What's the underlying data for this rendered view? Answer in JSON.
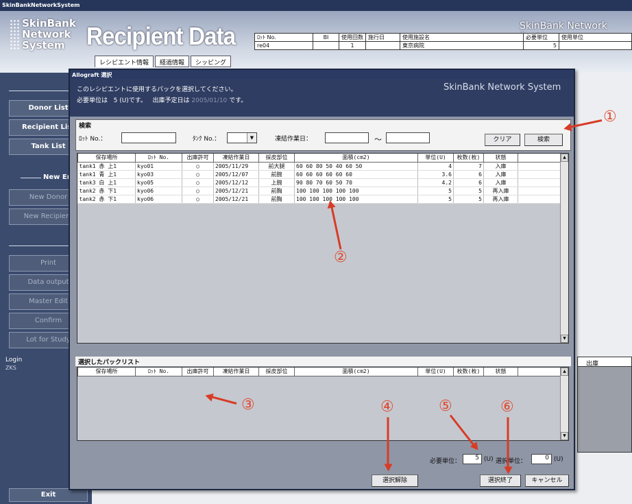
{
  "window": {
    "title": "SkinBankNetworkSystem"
  },
  "logo": {
    "line1": "SkinBank",
    "line2": "Network",
    "line3": "System"
  },
  "banner": {
    "title": "Recipient Data",
    "system_name": "SkinBank Network System"
  },
  "tabs": [
    "レシピエント情報",
    "経過情報",
    "シッピング"
  ],
  "header_table": {
    "headers": [
      "ﾛｯﾄ No.",
      "BI",
      "使用回数",
      "施行日",
      "使用施設名",
      "必要単位",
      "使用単位"
    ],
    "row": [
      "re04",
      "",
      "1",
      "",
      "東京病院",
      "5",
      ""
    ]
  },
  "sidebar": {
    "buttons": [
      "Donor List",
      "Recipient List",
      "Tank List"
    ],
    "section_new": "New Entry",
    "new_buttons": [
      "New Donor",
      "New Recipient"
    ],
    "ops": [
      "Print",
      "Data output",
      "Master Edit",
      "Confirm",
      "Lot for Study"
    ],
    "login_label": "Login",
    "login_user": "ZKS",
    "exit": "Exit"
  },
  "background": {
    "col_header": "出庫"
  },
  "dialog": {
    "title": "Allograft 選択",
    "system_name": "SkinBank Network System",
    "message": "このレシピエントに使用するパックを選択してください。",
    "required_prefix": "必要単位は",
    "required_value": "5 (U)です。",
    "date_prefix": "出庫予定日は",
    "date_value": "2005/01/10",
    "date_suffix": "です。",
    "search": {
      "section_label": "検索",
      "lot_label": "ﾛｯﾄ No.：",
      "tank_label": "ﾀﾝｸ No.：",
      "date_label": "凍結作業日：",
      "tilde": "～",
      "clear_button": "クリア",
      "search_button": "検索"
    },
    "grid_headers": [
      "保存場所",
      "ﾛｯﾄ No.",
      "出庫許可",
      "凍結作業日",
      "採皮部位",
      "面積(cm2)",
      "単位(U)",
      "枚数(枚)",
      "状態"
    ],
    "rows": [
      [
        "tank1 赤 上1",
        "kyo01",
        "○",
        "2005/11/29",
        "前大腿",
        "60 60 80 50 40 60 50",
        "4",
        "7",
        "入庫"
      ],
      [
        "tank1 青 上1",
        "kyo03",
        "○",
        "2005/12/07",
        "前腕",
        "60 60 60 60 60 60",
        "3.6",
        "6",
        "入庫"
      ],
      [
        "tank3 白 上1",
        "kyo05",
        "○",
        "2005/12/12",
        "上腕",
        "90 80 70 60 50 70",
        "4.2",
        "6",
        "入庫"
      ],
      [
        "tank2 赤 下1",
        "kyo06",
        "○",
        "2005/12/21",
        "前胸",
        "100 100 100 100 100",
        "5",
        "5",
        "再入庫"
      ],
      [
        "tank2 赤 下1",
        "kyo06",
        "○",
        "2005/12/21",
        "前胸",
        "100 100 100 100 100",
        "5",
        "5",
        "再入庫"
      ]
    ],
    "selected_label": "選択したパックリスト",
    "required_units_label": "必要単位：",
    "required_units_value": "5",
    "selected_units_label": "選択単位：",
    "selected_units_value": "0",
    "unit": "(U)",
    "deselect_button": "選択解除",
    "finish_button": "選択終了",
    "cancel_button": "キャンセル"
  },
  "annotations": [
    "①",
    "②",
    "③",
    "④",
    "⑤",
    "⑥"
  ],
  "colors": {
    "annotation": "#d93b26",
    "dialog_header": "#2f3d62",
    "sidebar": "#3a4b6e"
  }
}
